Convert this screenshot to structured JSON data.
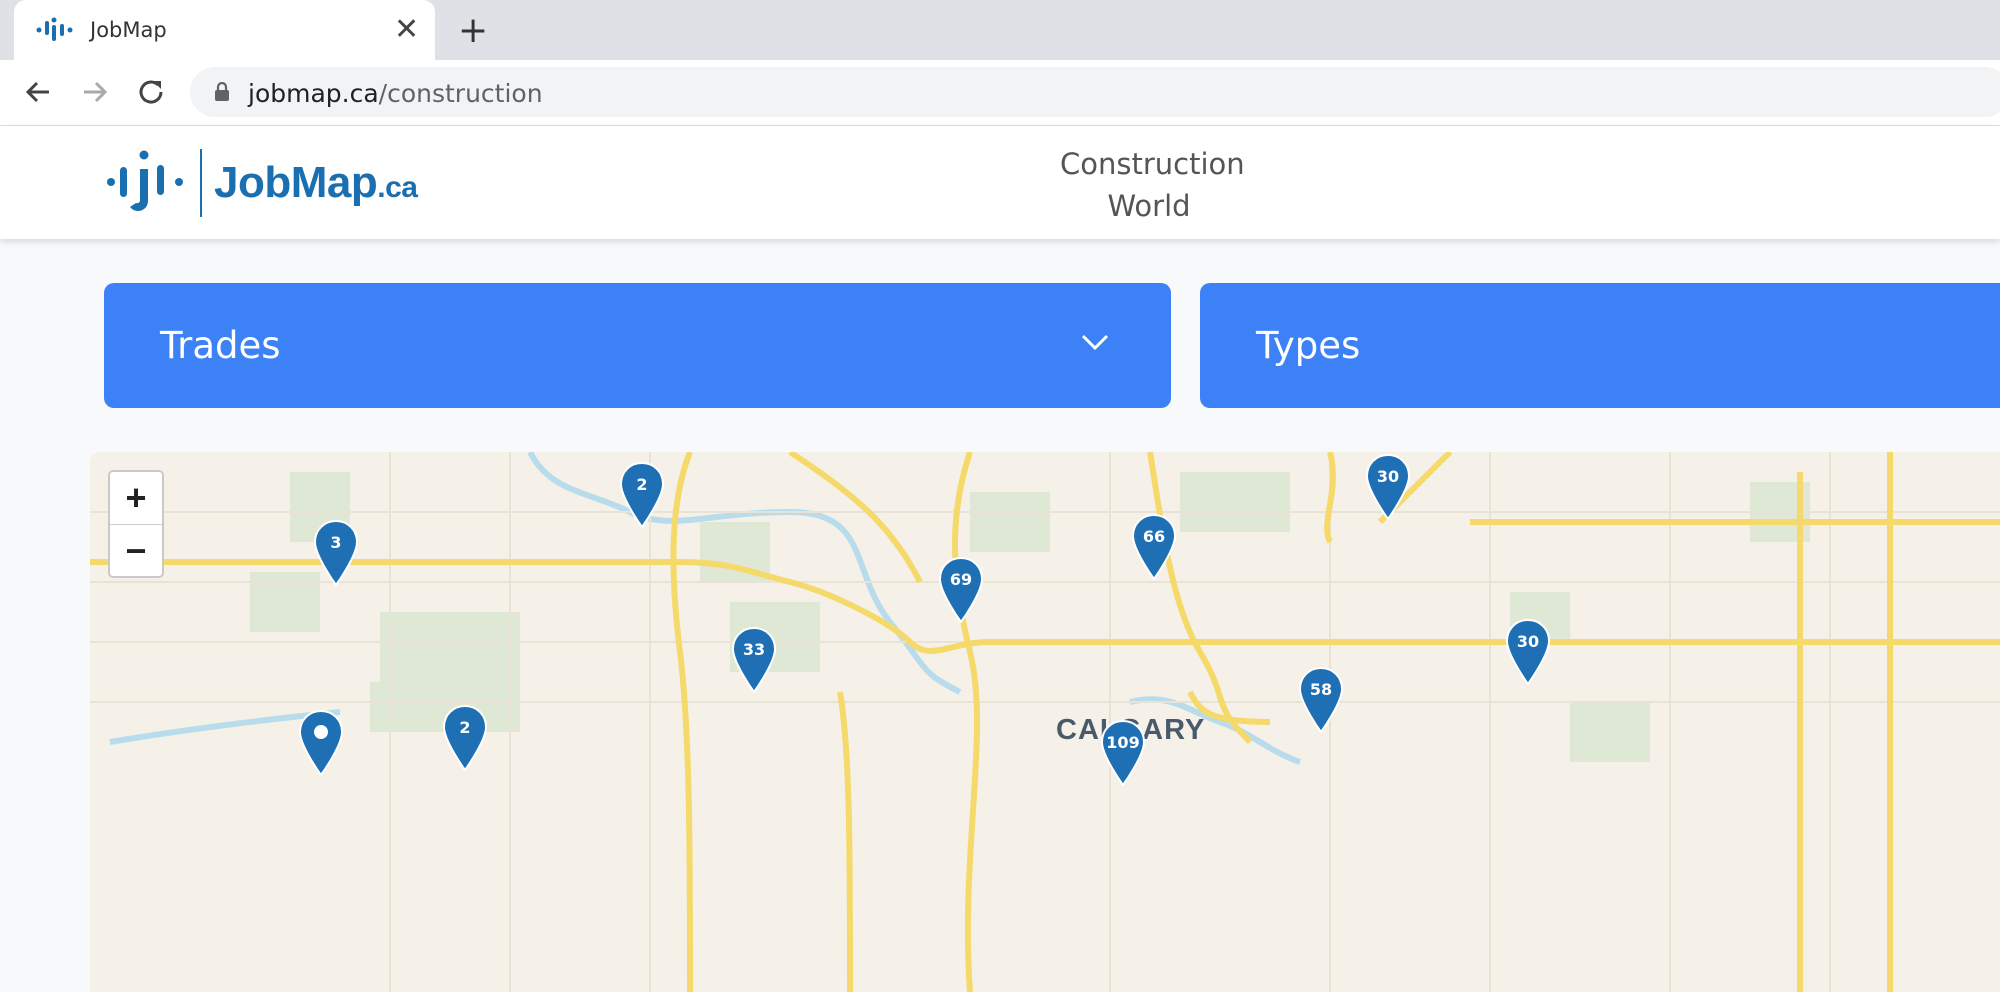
{
  "browser": {
    "tab_title": "JobMap",
    "url_host": "jobmap.ca",
    "url_path": "/construction"
  },
  "site": {
    "logo_main": "JobMap",
    "logo_tld": ".ca",
    "nav_line1": "Construction",
    "nav_line2": "World"
  },
  "filters": {
    "trades_label": "Trades",
    "types_label": "Types"
  },
  "map": {
    "zoom_in": "+",
    "zoom_out": "−",
    "city": "CALGARY",
    "markers": [
      "2",
      "3",
      "30",
      "66",
      "69",
      "33",
      "30",
      "58",
      "2",
      "109",
      ""
    ]
  },
  "colors": {
    "accent": "#3c82f6",
    "brand": "#1a6fb0",
    "marker": "#1f6fb5"
  }
}
